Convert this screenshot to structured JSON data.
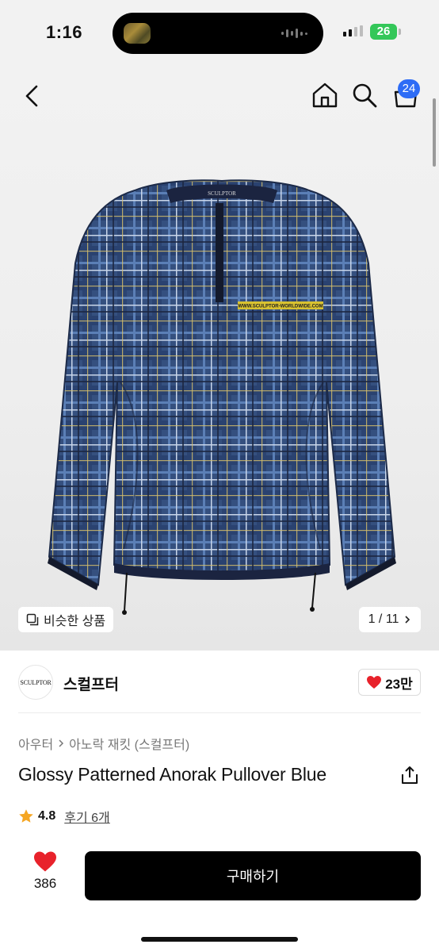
{
  "status_bar": {
    "time": "1:16",
    "battery": "26"
  },
  "nav": {
    "back_icon": "chevron-left-icon",
    "home_icon": "home-icon",
    "search_icon": "search-icon",
    "cart_icon": "cart-icon",
    "cart_count": "24"
  },
  "hero": {
    "label_on_jacket": "WWW.SCULPTOR-WORLDWIDE.COM",
    "collar_label": "SCULPTOR",
    "similar_label": "비슷한 상품",
    "page_counter": "1 / 11"
  },
  "shop": {
    "logo_text": "SCULPTOR",
    "name": "스컬프터",
    "likes": "23만"
  },
  "product": {
    "breadcrumb_category": "아우터",
    "breadcrumb_sub": "아노락 재킷 (스컬프터)",
    "title": "Glossy Patterned Anorak Pullover Blue",
    "rating": "4.8",
    "reviews": "후기 6개"
  },
  "bottom": {
    "like_count": "386",
    "buy_label": "구매하기"
  },
  "colors": {
    "accent_blue": "#2d6cf6",
    "heart_red": "#e8222b",
    "star_gold": "#f5a623",
    "buy_button": "#000000",
    "battery_green": "#34c759"
  }
}
